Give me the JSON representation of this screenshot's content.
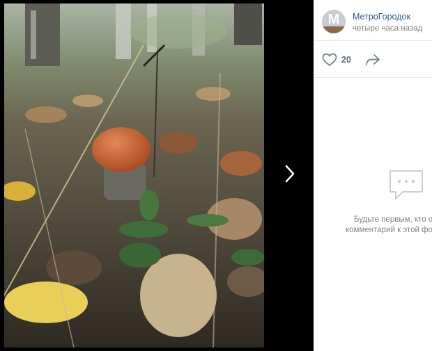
{
  "post": {
    "author_name": "МетроГородок",
    "post_time": "четыре часа назад",
    "avatar_letter": "M"
  },
  "actions": {
    "likes_count": "20"
  },
  "comments": {
    "empty_line1": "Будьте первым, кто о",
    "empty_line2": "комментарий к этой фо"
  },
  "icons": {
    "like": "heart-icon",
    "share": "share-arrow-icon",
    "next": "chevron-right-icon",
    "comments": "comment-bubble-icon"
  },
  "colors": {
    "link": "#2a5885",
    "muted": "#828282",
    "viewer_bg": "#000000"
  }
}
